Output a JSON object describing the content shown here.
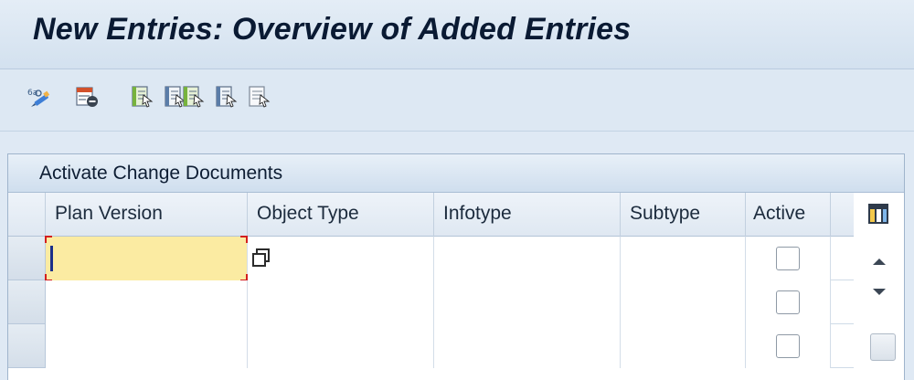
{
  "window": {
    "title": "New Entries: Overview of Added Entries"
  },
  "toolbar": {
    "buttons": [
      {
        "icon": "display-change-icon"
      },
      {
        "icon": "delete-row-icon"
      },
      {
        "icon": "select-all-icon"
      },
      {
        "icon": "select-block-icon"
      },
      {
        "icon": "deselect-all-icon"
      },
      {
        "icon": "select-icon"
      }
    ]
  },
  "table": {
    "title": "Activate Change Documents",
    "columns": [
      "Plan Version",
      "Object Type",
      "Infotype",
      "Subtype",
      "Active"
    ],
    "rows": [
      {
        "plan_version": "",
        "object_type": "",
        "infotype": "",
        "subtype": "",
        "active": false
      },
      {
        "plan_version": "",
        "object_type": "",
        "infotype": "",
        "subtype": "",
        "active": false
      },
      {
        "plan_version": "",
        "object_type": "",
        "infotype": "",
        "subtype": "",
        "active": false
      }
    ],
    "icons": {
      "column_settings": "table-settings-icon",
      "scroll_up": "scroll-up-icon",
      "scroll_down": "scroll-down-icon",
      "value_help": "value-help-icon"
    }
  },
  "colors": {
    "title_text": "#0a1a33",
    "focused_cell": "#fbeba2",
    "focus_marker": "#d21f1f",
    "header_bg": "#dde8f3"
  }
}
